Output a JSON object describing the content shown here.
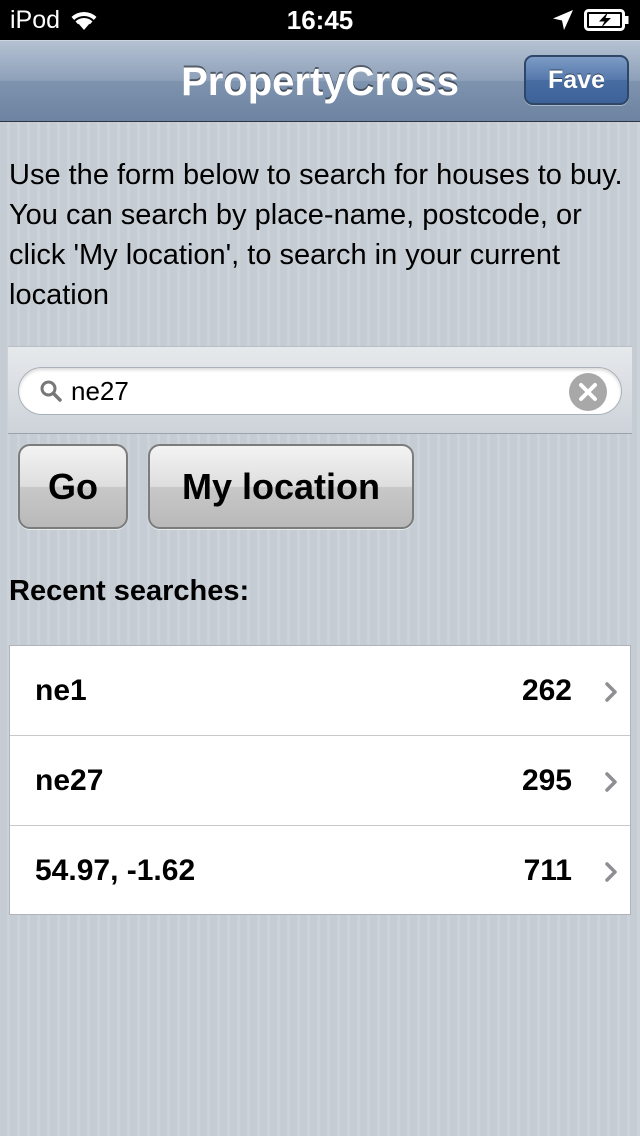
{
  "status_bar": {
    "carrier": "iPod",
    "time": "16:45",
    "icons": [
      "wifi-icon",
      "location-arrow-icon",
      "battery-charging-icon"
    ]
  },
  "nav": {
    "title": "PropertyCross",
    "fave_label": "Fave",
    "accent": "#6d83a1"
  },
  "intro": {
    "text": "Use the form below to search for houses to buy. You can search by place-name, postcode, or click 'My location', to search in your current location"
  },
  "search": {
    "value": "ne27",
    "placeholder": ""
  },
  "buttons": {
    "go_label": "Go",
    "location_label": "My location"
  },
  "recent": {
    "heading": "Recent searches:",
    "items": [
      {
        "label": "ne1",
        "count": "262"
      },
      {
        "label": "ne27",
        "count": "295"
      },
      {
        "label": "54.97, -1.62",
        "count": "711"
      }
    ]
  }
}
